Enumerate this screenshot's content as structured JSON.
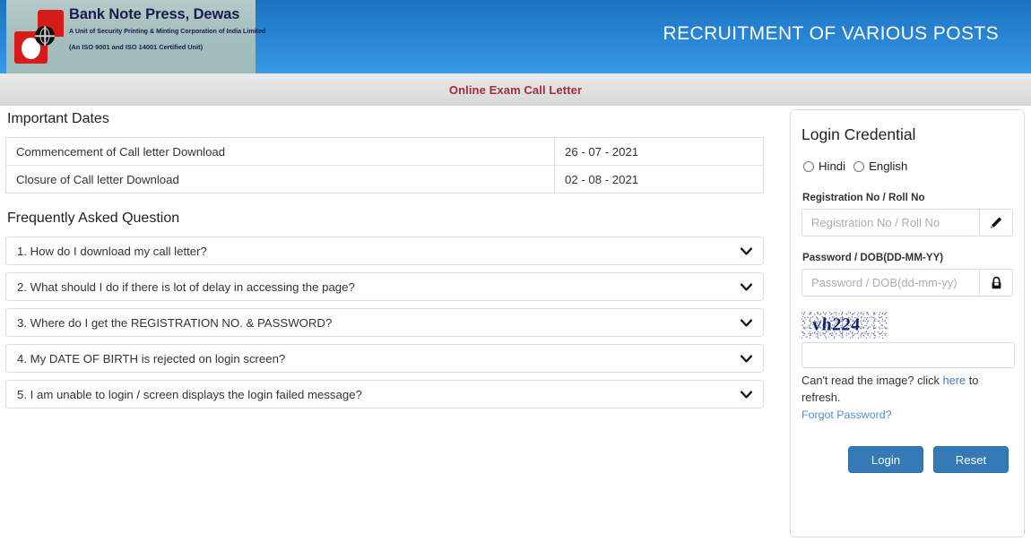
{
  "header": {
    "logo": {
      "title": "Bank Note Press, Dewas",
      "subtitle1": "A Unit of Security Printing & Minting Corporation of India Limited",
      "subtitle2": "(An ISO 9001 and ISO 14001 Certified Unit)"
    },
    "title": "RECRUITMENT OF VARIOUS POSTS",
    "accent_blue": "#2a86d6",
    "logo_band_color": "#a4bfbd"
  },
  "subheader": {
    "text": "Online Exam Call Letter",
    "color": "#a32d3a"
  },
  "important_dates": {
    "heading": "Important Dates",
    "rows": [
      {
        "label": "Commencement of Call letter Download",
        "value": "26 - 07 - 2021"
      },
      {
        "label": "Closure of Call letter Download",
        "value": "02 - 08 - 2021"
      }
    ]
  },
  "faq": {
    "heading": "Frequently Asked Question",
    "items": [
      {
        "question": "1. How do I download my call letter?",
        "icon": "chevron-down-icon"
      },
      {
        "question": "2. What should I do if there is lot of delay in accessing the page?",
        "icon": "chevron-down-icon"
      },
      {
        "question": "3. Where do I get the REGISTRATION NO. & PASSWORD?",
        "icon": "chevron-down-icon"
      },
      {
        "question": "4. My DATE OF BIRTH is rejected on login screen?",
        "icon": "chevron-down-icon"
      },
      {
        "question": "5. I am unable to login / screen displays the login failed message?",
        "icon": "chevron-down-icon"
      }
    ]
  },
  "login": {
    "heading": "Login Credential",
    "language_options": [
      {
        "label": "Hindi",
        "selected": false
      },
      {
        "label": "English",
        "selected": false
      }
    ],
    "registration": {
      "label": "Registration No / Roll No",
      "placeholder": "Registration No / Roll No",
      "value": "",
      "addon_icon": "pencil-icon"
    },
    "password": {
      "label": "Password / DOB(DD-MM-YY)",
      "placeholder": "Password / DOB(dd-mm-yy)",
      "value": "",
      "addon_icon": "lock-icon"
    },
    "captcha": {
      "text": "vh224",
      "input_value": "",
      "input_placeholder": ""
    },
    "refresh_note_before": "Can't read the image? click ",
    "refresh_link": "here",
    "refresh_note_after": " to refresh.",
    "forgot_password": "Forgot Password?",
    "buttons": {
      "login": "Login",
      "reset": "Reset"
    },
    "button_color": "#337ab7"
  }
}
